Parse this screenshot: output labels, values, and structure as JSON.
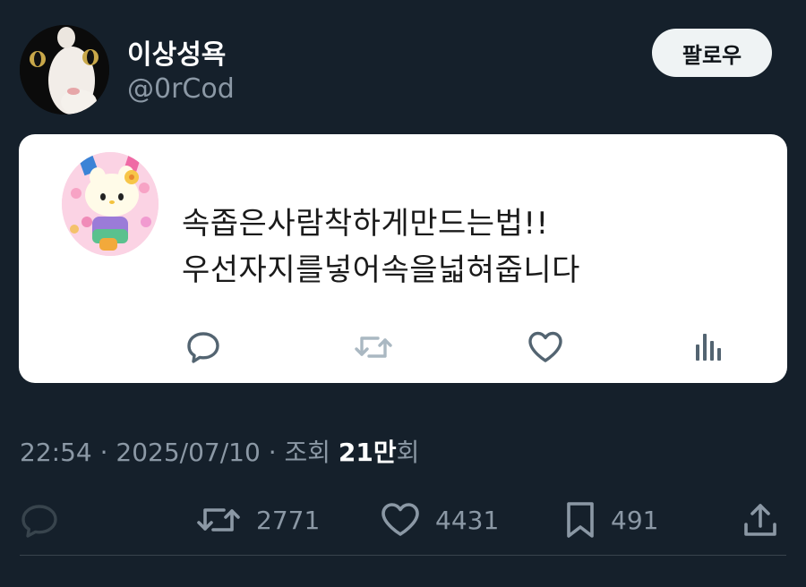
{
  "author": {
    "display_name": "이상성욕",
    "handle": "@0rCod"
  },
  "follow_button": {
    "label": "팔로우"
  },
  "quoted_post": {
    "text": "속좁은사람착하게만드는법!!\n우선자지를넣어속을넓혀줍니다",
    "icons": [
      "reply-icon",
      "retweet-icon",
      "like-icon",
      "views-icon"
    ]
  },
  "meta": {
    "time": "22:54",
    "sep1": " · ",
    "date": "2025/07/10",
    "sep2": " · ",
    "views_label": "조회 ",
    "views_count": "21만",
    "views_suffix": "회"
  },
  "actions": {
    "reply": {
      "icon": "reply-icon"
    },
    "retweet": {
      "icon": "retweet-icon",
      "count": "2771"
    },
    "like": {
      "icon": "heart-icon",
      "count": "4431"
    },
    "bookmark": {
      "icon": "bookmark-icon",
      "count": "491"
    },
    "share": {
      "icon": "share-icon"
    }
  },
  "colors": {
    "background": "#15202b",
    "text_primary": "#ffffff",
    "text_secondary": "#8b98a5",
    "card_background": "#ffffff",
    "card_icons": "#536471",
    "card_retweet_disabled": "#aab8c2",
    "follow_button": "#eff3f4"
  }
}
